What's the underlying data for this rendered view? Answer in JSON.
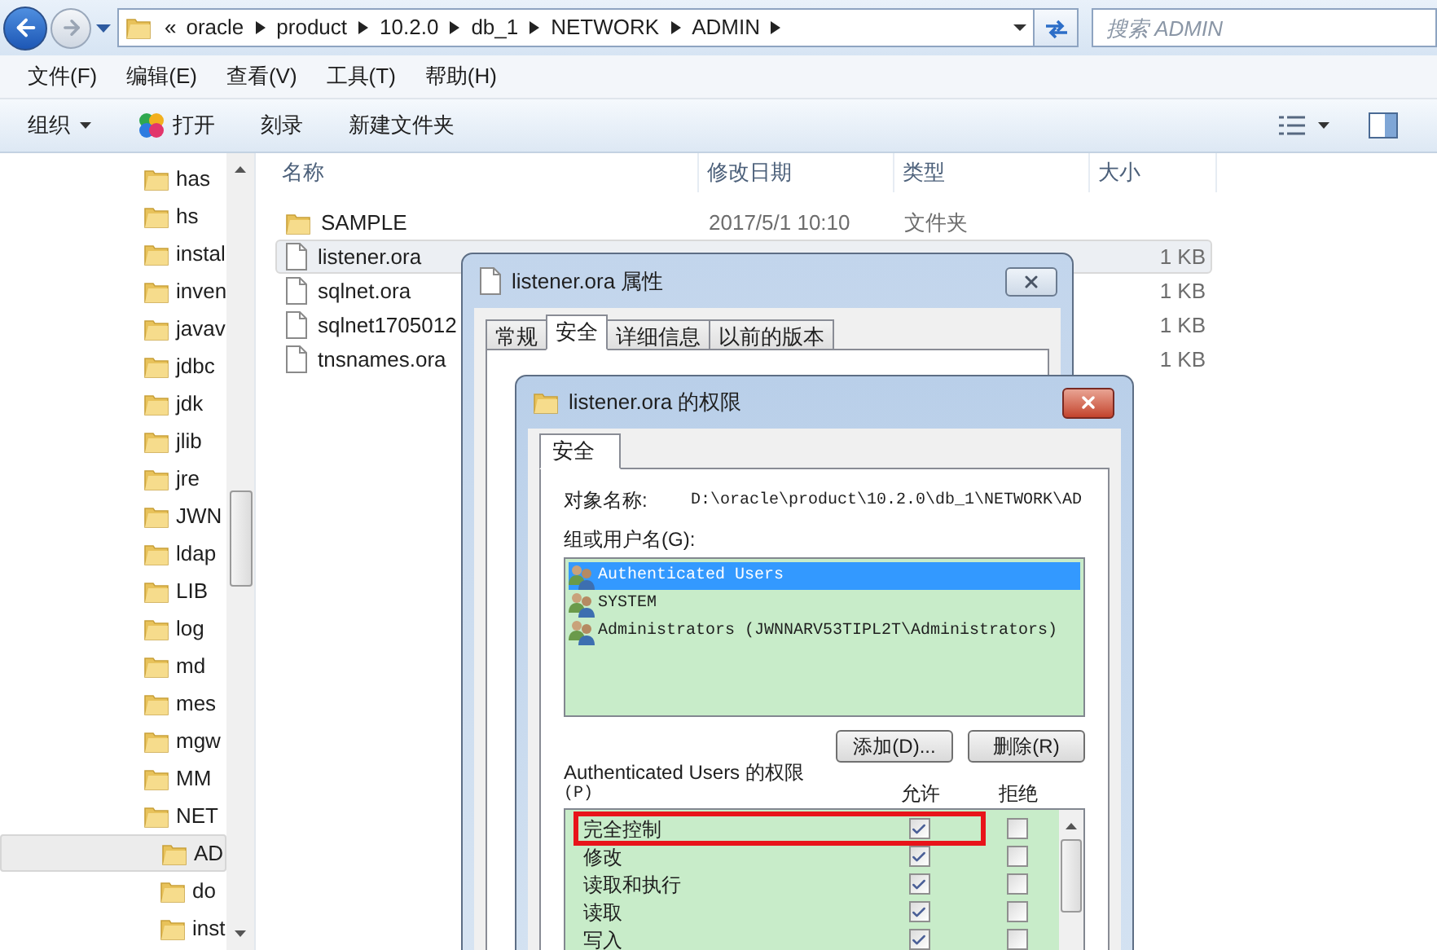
{
  "address_bar": {
    "overflow_mark": "«",
    "crumbs": [
      "oracle",
      "product",
      "10.2.0",
      "db_1",
      "NETWORK",
      "ADMIN"
    ]
  },
  "search": {
    "placeholder": "搜索 ADMIN"
  },
  "menu": [
    "文件(F)",
    "编辑(E)",
    "查看(V)",
    "工具(T)",
    "帮助(H)"
  ],
  "toolbar": [
    {
      "label": "组织",
      "kind": "dropdown"
    },
    {
      "label": "打开",
      "kind": "program"
    },
    {
      "label": "刻录",
      "kind": "plain"
    },
    {
      "label": "新建文件夹",
      "kind": "plain"
    }
  ],
  "nav_tree": [
    {
      "label": "has",
      "selected": false
    },
    {
      "label": "hs",
      "selected": false
    },
    {
      "label": "instal",
      "selected": false
    },
    {
      "label": "inven",
      "selected": false
    },
    {
      "label": "javav",
      "selected": false
    },
    {
      "label": "jdbc",
      "selected": false
    },
    {
      "label": "jdk",
      "selected": false
    },
    {
      "label": "jlib",
      "selected": false
    },
    {
      "label": "jre",
      "selected": false
    },
    {
      "label": "JWN",
      "selected": false
    },
    {
      "label": "ldap",
      "selected": false
    },
    {
      "label": "LIB",
      "selected": false
    },
    {
      "label": "log",
      "selected": false
    },
    {
      "label": "md",
      "selected": false
    },
    {
      "label": "mes",
      "selected": false
    },
    {
      "label": "mgw",
      "selected": false
    },
    {
      "label": "MM",
      "selected": false
    },
    {
      "label": "NET",
      "selected": false,
      "children": [
        {
          "label": "AD",
          "selected": true
        },
        {
          "label": "do",
          "selected": false
        },
        {
          "label": "inst",
          "selected": false
        }
      ]
    }
  ],
  "file_list": {
    "columns": [
      "名称",
      "修改日期",
      "类型",
      "大小"
    ],
    "rows": [
      {
        "name": "SAMPLE",
        "kind": "folder",
        "date": "2017/5/1 10:10",
        "type": "文件夹",
        "selected": false
      },
      {
        "name": "listener.ora",
        "kind": "file",
        "size": "1 KB",
        "selected": true
      },
      {
        "name": "sqlnet.ora",
        "kind": "file",
        "size": "1 KB",
        "selected": false
      },
      {
        "name": "sqlnet1705012",
        "kind": "file",
        "size": "1 KB",
        "selected": false
      },
      {
        "name": "tnsnames.ora",
        "kind": "file",
        "size": "1 KB",
        "selected": false
      }
    ]
  },
  "properties_dialog": {
    "title": "listener.ora 属性",
    "tabs": [
      {
        "label": "常规",
        "selected": false
      },
      {
        "label": "安全",
        "selected": true
      },
      {
        "label": "详细信息",
        "selected": false
      },
      {
        "label": "以前的版本",
        "selected": false
      }
    ]
  },
  "permissions_dialog": {
    "title": "listener.ora 的权限",
    "tabs": [
      {
        "label": "安全",
        "selected": true
      }
    ],
    "object_label": "对象名称:",
    "object_value": "D:\\oracle\\product\\10.2.0\\db_1\\NETWORK\\AD",
    "groups_label": "组或用户名(G):",
    "groups": [
      {
        "name": "Authenticated Users",
        "selected": true
      },
      {
        "name": "SYSTEM",
        "selected": false
      },
      {
        "name": "Administrators (JWNNARV53TIPL2T\\Administrators)",
        "selected": false
      }
    ],
    "buttons": [
      "添加(D)...",
      "删除(R)"
    ],
    "permissions_label": "Authenticated Users 的权限",
    "permissions_key": "(P)",
    "columns": [
      "允许",
      "拒绝"
    ],
    "permissions": [
      {
        "name": "完全控制",
        "allow": true,
        "deny": false,
        "highlighted": true
      },
      {
        "name": "修改",
        "allow": true,
        "deny": false,
        "highlighted": false
      },
      {
        "name": "读取和执行",
        "allow": true,
        "deny": false,
        "highlighted": false
      },
      {
        "name": "读取",
        "allow": true,
        "deny": false,
        "highlighted": false
      },
      {
        "name": "写入",
        "allow": true,
        "deny": false,
        "highlighted": false
      }
    ]
  }
}
